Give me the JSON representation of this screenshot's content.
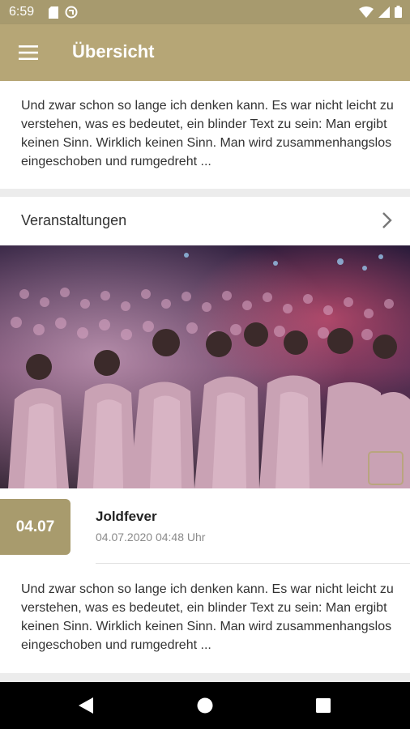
{
  "status_bar": {
    "time": "6:59",
    "icons": [
      "sd-card-icon",
      "sync-icon",
      "wifi-icon",
      "signal-icon",
      "battery-icon"
    ]
  },
  "app_bar": {
    "title": "Übersicht",
    "color": "#b6a676",
    "menu_icon": "hamburger-menu-icon"
  },
  "intro": {
    "text": "Und zwar schon so lange ich denken kann. Es war nicht leicht zu verstehen, was es bedeutet, ein blinder Text zu sein: Man ergibt keinen Sinn. Wirklich keinen Sinn. Man wird zusammenhangslos eingeschoben und rumgedreht ..."
  },
  "events": {
    "section_title": "Veranstaltungen",
    "chevron_icon": "chevron-right-icon",
    "items": [
      {
        "date_badge": "04.07",
        "title": "Joldfever",
        "datetime": "04.07.2020 04:48 Uhr",
        "text": "Und zwar schon so lange ich denken kann. Es war nicht leicht zu verstehen, was es bedeutet, ein blinder Text zu sein: Man ergibt keinen Sinn. Wirklich keinen Sinn. Man wird zusammenhangslos eingeschoben und rumgedreht ..."
      }
    ]
  },
  "nav_bar": {
    "buttons": [
      "back-icon",
      "home-icon",
      "recents-icon"
    ]
  },
  "colors": {
    "accent": "#b6a676",
    "badge": "#a89b6d",
    "status_bar": "#a79a6e"
  }
}
